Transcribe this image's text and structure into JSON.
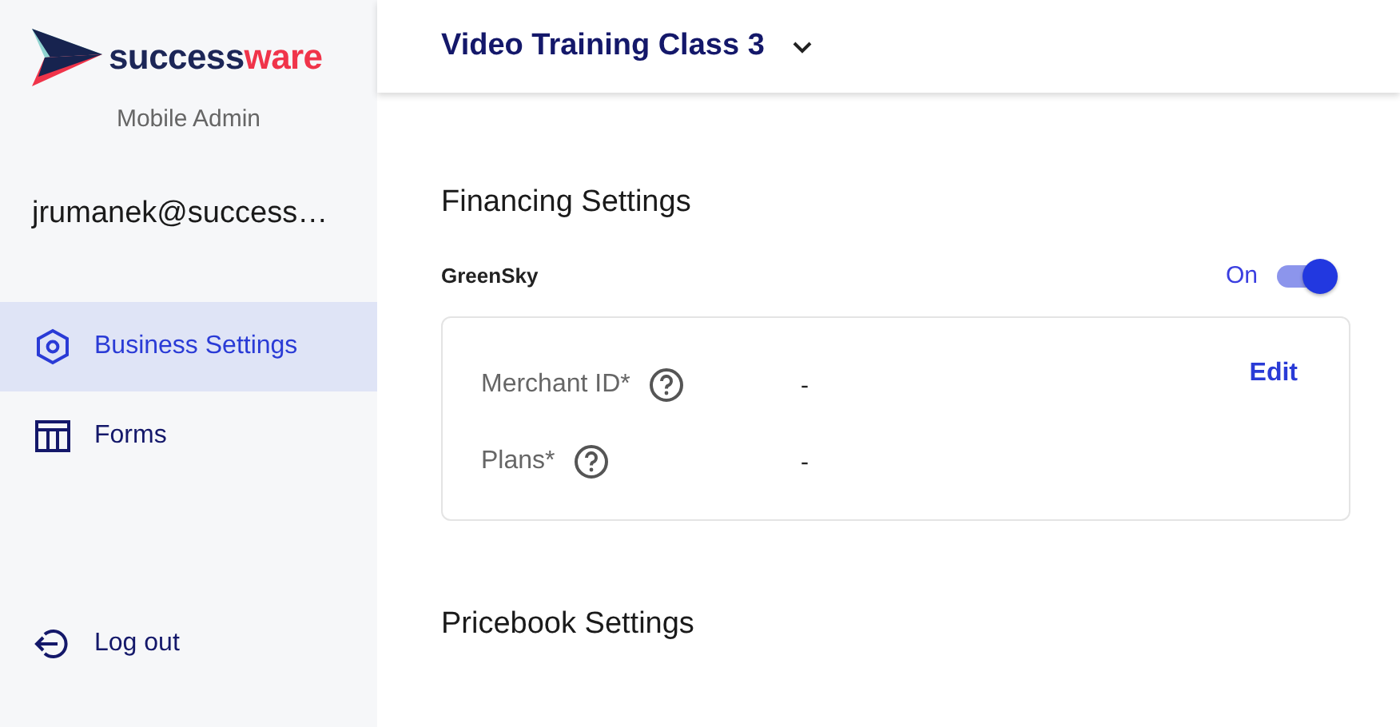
{
  "sidebar": {
    "logo": {
      "name_first": "success",
      "name_second": "ware"
    },
    "subtitle": "Mobile Admin",
    "user": "jrumanek@success…",
    "items": [
      {
        "label": "Business Settings",
        "kind": "settings",
        "selected": true
      },
      {
        "label": "Forms",
        "kind": "forms",
        "selected": false
      }
    ],
    "logout": "Log out"
  },
  "header": {
    "title": "Video Training Class 3"
  },
  "sections": [
    {
      "title": "Financing Settings",
      "providers": [
        {
          "name": "GreenSky",
          "status": "On",
          "on": true,
          "action": "Edit",
          "fields": [
            {
              "label": "Merchant ID*",
              "value": "-"
            },
            {
              "label": "Plans*",
              "value": "-"
            }
          ]
        }
      ]
    },
    {
      "title": "Pricebook Settings"
    }
  ]
}
